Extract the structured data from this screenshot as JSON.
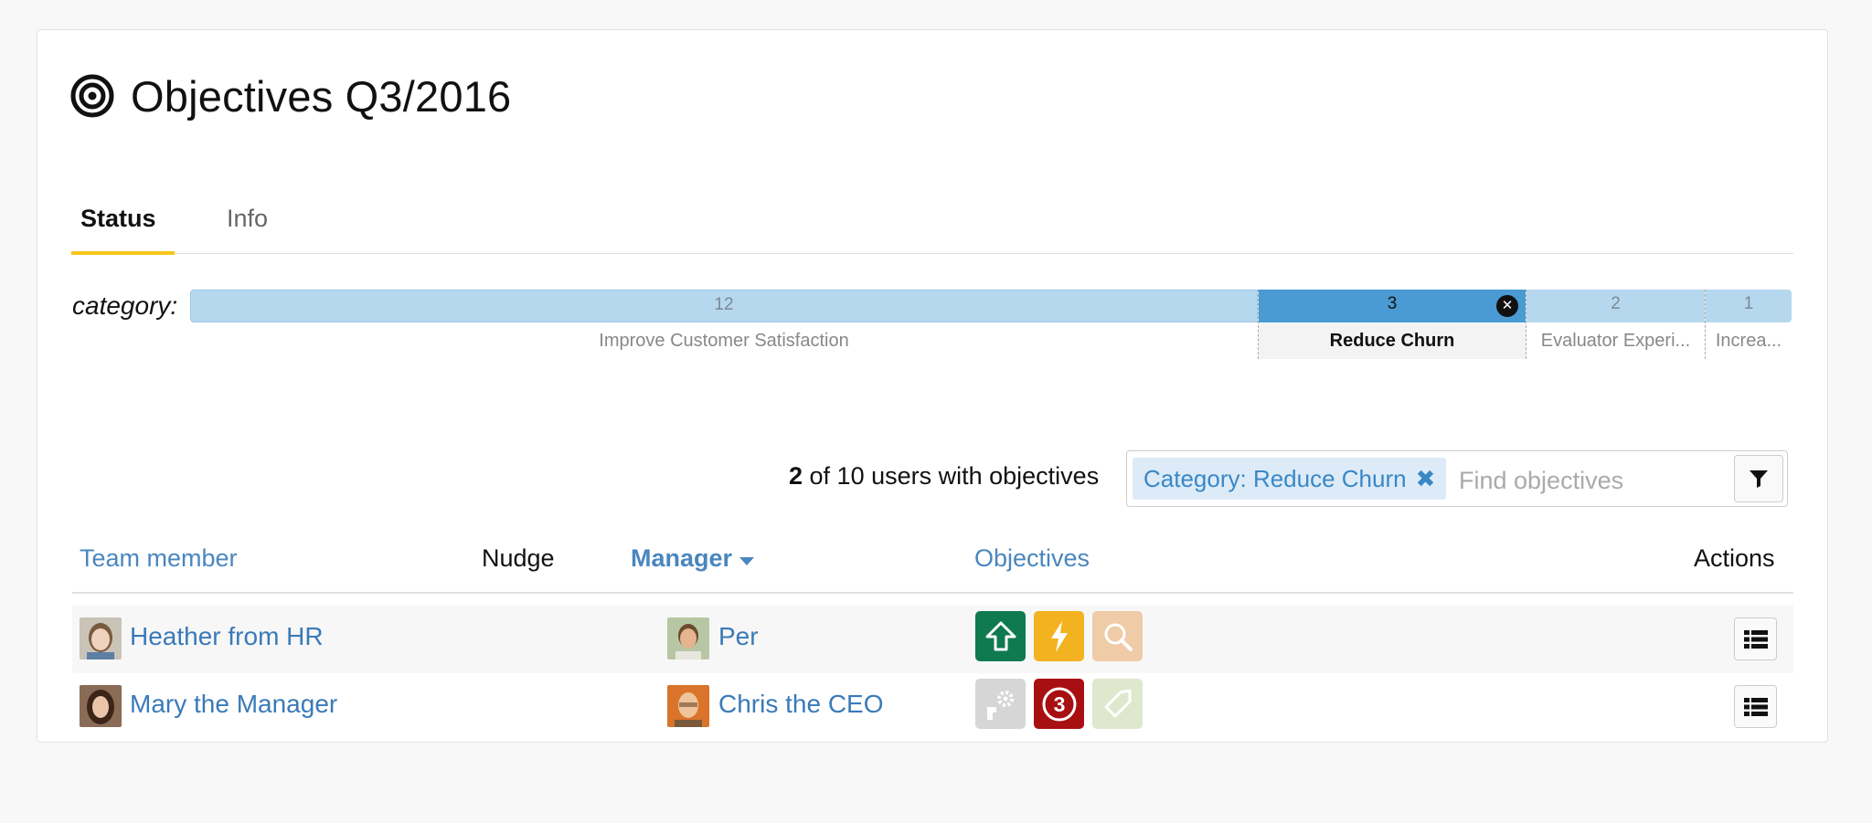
{
  "page": {
    "title": "Objectives Q3/2016"
  },
  "tabs": [
    {
      "label": "Status"
    },
    {
      "label": "Info"
    }
  ],
  "category": {
    "label": "category:",
    "segments": [
      {
        "count": "12",
        "label": "Improve Customer Satisfaction"
      },
      {
        "count": "3",
        "label": "Reduce Churn",
        "selected": true
      },
      {
        "count": "2",
        "label": "Evaluator Experi..."
      },
      {
        "count": "1",
        "label": "Increa..."
      }
    ]
  },
  "summary": {
    "shown": "2",
    "rest": " of 10 users with objectives"
  },
  "filter": {
    "chip_label": "Category: Reduce Churn",
    "chip_remove": "✖",
    "placeholder": "Find objectives"
  },
  "table": {
    "headers": {
      "team_member": "Team member",
      "nudge": "Nudge",
      "manager": "Manager",
      "objectives": "Objectives",
      "actions": "Actions"
    },
    "rows": [
      {
        "member": "Heather from HR",
        "manager": "Per",
        "objectives": [
          {
            "icon": "arrow-up-icon",
            "color": "#0f7a4f"
          },
          {
            "icon": "lightning-icon",
            "color": "#f3b21f"
          },
          {
            "icon": "magnifier-icon",
            "color": "#efcba7"
          }
        ]
      },
      {
        "member": "Mary the Manager",
        "manager": "Chris the CEO",
        "objectives": [
          {
            "icon": "gears-icon",
            "color": "#d6d6d6"
          },
          {
            "icon": "number-3-icon",
            "color": "#a80f12",
            "text": "3"
          },
          {
            "icon": "tag-icon",
            "color": "#dfe8cd"
          }
        ]
      }
    ]
  },
  "colors": {
    "accent": "#f5c518",
    "link": "#4a86bf",
    "selected_segment": "#4a9ad4",
    "segment": "#b6d8ee"
  }
}
